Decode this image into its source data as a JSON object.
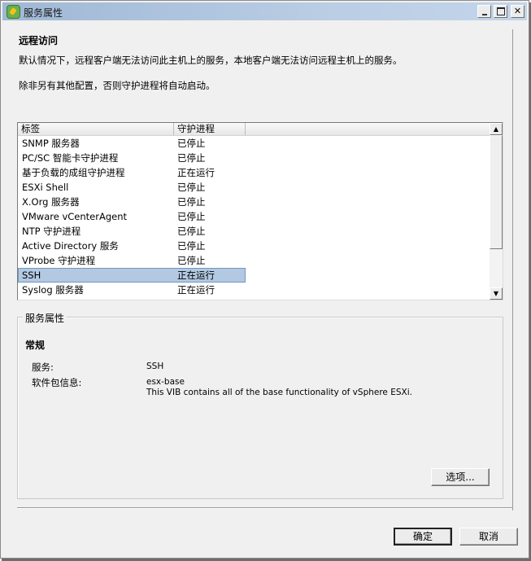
{
  "window": {
    "title": "服务属性",
    "controls": {
      "minimize": "minimize",
      "maximize": "maximize",
      "close": "close"
    }
  },
  "remote_access": {
    "title": "远程访问",
    "description_1": "默认情况下，远程客户端无法访问此主机上的服务，本地客户端无法访问远程主机上的服务。",
    "description_2": "除非另有其他配置，否则守护进程将自动启动。"
  },
  "service_list": {
    "columns": [
      "标签",
      "守护进程",
      ""
    ],
    "rows": [
      {
        "label": "SNMP 服务器",
        "status": "已停止"
      },
      {
        "label": "PC/SC 智能卡守护进程",
        "status": "已停止"
      },
      {
        "label": "基于负载的成组守护进程",
        "status": "正在运行"
      },
      {
        "label": "ESXi Shell",
        "status": "已停止"
      },
      {
        "label": "X.Org 服务器",
        "status": "已停止"
      },
      {
        "label": "VMware vCenterAgent",
        "status": "已停止"
      },
      {
        "label": "NTP 守护进程",
        "status": "已停止"
      },
      {
        "label": "Active Directory 服务",
        "status": "已停止"
      },
      {
        "label": "VProbe 守护进程",
        "status": "已停止"
      },
      {
        "label": "SSH",
        "status": "正在运行",
        "selected": true
      },
      {
        "label": "Syslog 服务器",
        "status": "正在运行"
      }
    ],
    "selection_color": "#b3c8e1"
  },
  "service_properties": {
    "legend": "服务属性",
    "section": "常规",
    "service_label": "服务:",
    "service_value": "SSH",
    "package_label": "软件包信息:",
    "package_name": "esx-base",
    "package_desc": "This VIB contains all of the base functionality of vSphere ESXi.",
    "options_button": "选项..."
  },
  "footer": {
    "ok_button": "确定",
    "cancel_button": "取消"
  }
}
